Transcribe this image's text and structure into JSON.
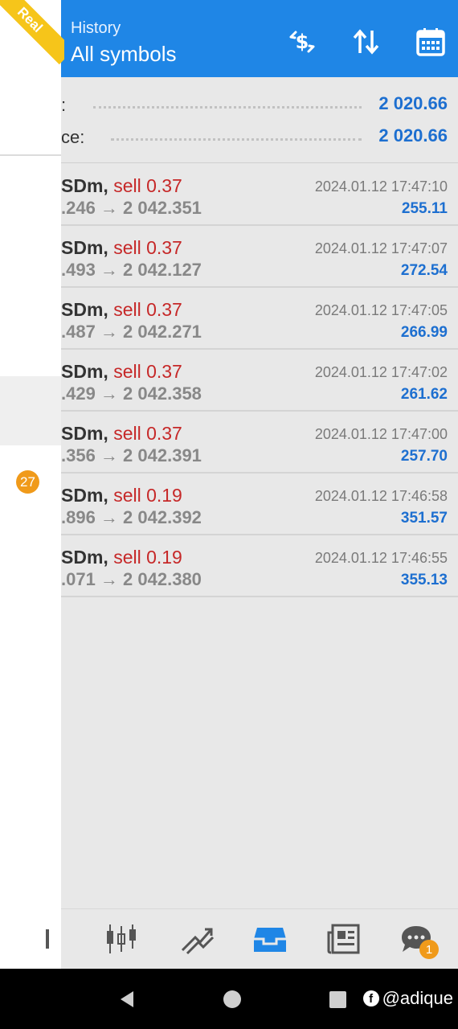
{
  "header": {
    "subtitle": "History",
    "title": "All symbols",
    "icons": [
      "currency-exchange-icon",
      "sort-icon",
      "calendar-icon"
    ]
  },
  "summary": [
    {
      "label": ":",
      "value": "2 020.66"
    },
    {
      "label": "ce:",
      "value": "2 020.66"
    }
  ],
  "trades": [
    {
      "symbol": "SDm,",
      "side": "sell 0.37",
      "prices": ".246 → 2 042.351",
      "time": "2024.01.12 17:47:10",
      "profit": "255.11"
    },
    {
      "symbol": "SDm,",
      "side": "sell 0.37",
      "prices": ".493 → 2 042.127",
      "time": "2024.01.12 17:47:07",
      "profit": "272.54"
    },
    {
      "symbol": "SDm,",
      "side": "sell 0.37",
      "prices": ".487 → 2 042.271",
      "time": "2024.01.12 17:47:05",
      "profit": "266.99"
    },
    {
      "symbol": "SDm,",
      "side": "sell 0.37",
      "prices": ".429 → 2 042.358",
      "time": "2024.01.12 17:47:02",
      "profit": "261.62"
    },
    {
      "symbol": "SDm,",
      "side": "sell 0.37",
      "prices": ".356 → 2 042.391",
      "time": "2024.01.12 17:47:00",
      "profit": "257.70"
    },
    {
      "symbol": "SDm,",
      "side": "sell 0.19",
      "prices": ".896 → 2 042.392",
      "time": "2024.01.12 17:46:58",
      "profit": "351.57"
    },
    {
      "symbol": "SDm,",
      "side": "sell 0.19",
      "prices": ".071 → 2 042.380",
      "time": "2024.01.12 17:46:55",
      "profit": "355.13"
    }
  ],
  "drawer": {
    "ribbon": "Real",
    "badge": "27"
  },
  "bottom_nav": {
    "items": [
      "quotes-icon",
      "chart-icon",
      "trade-icon",
      "history-icon",
      "news-icon",
      "chat-icon"
    ],
    "chat_badge": "1"
  },
  "watermark": "@adique",
  "colors": {
    "accent": "#1f86e6",
    "profit": "#1d6fd0",
    "sell": "#c62828",
    "badge": "#f09a1a"
  }
}
